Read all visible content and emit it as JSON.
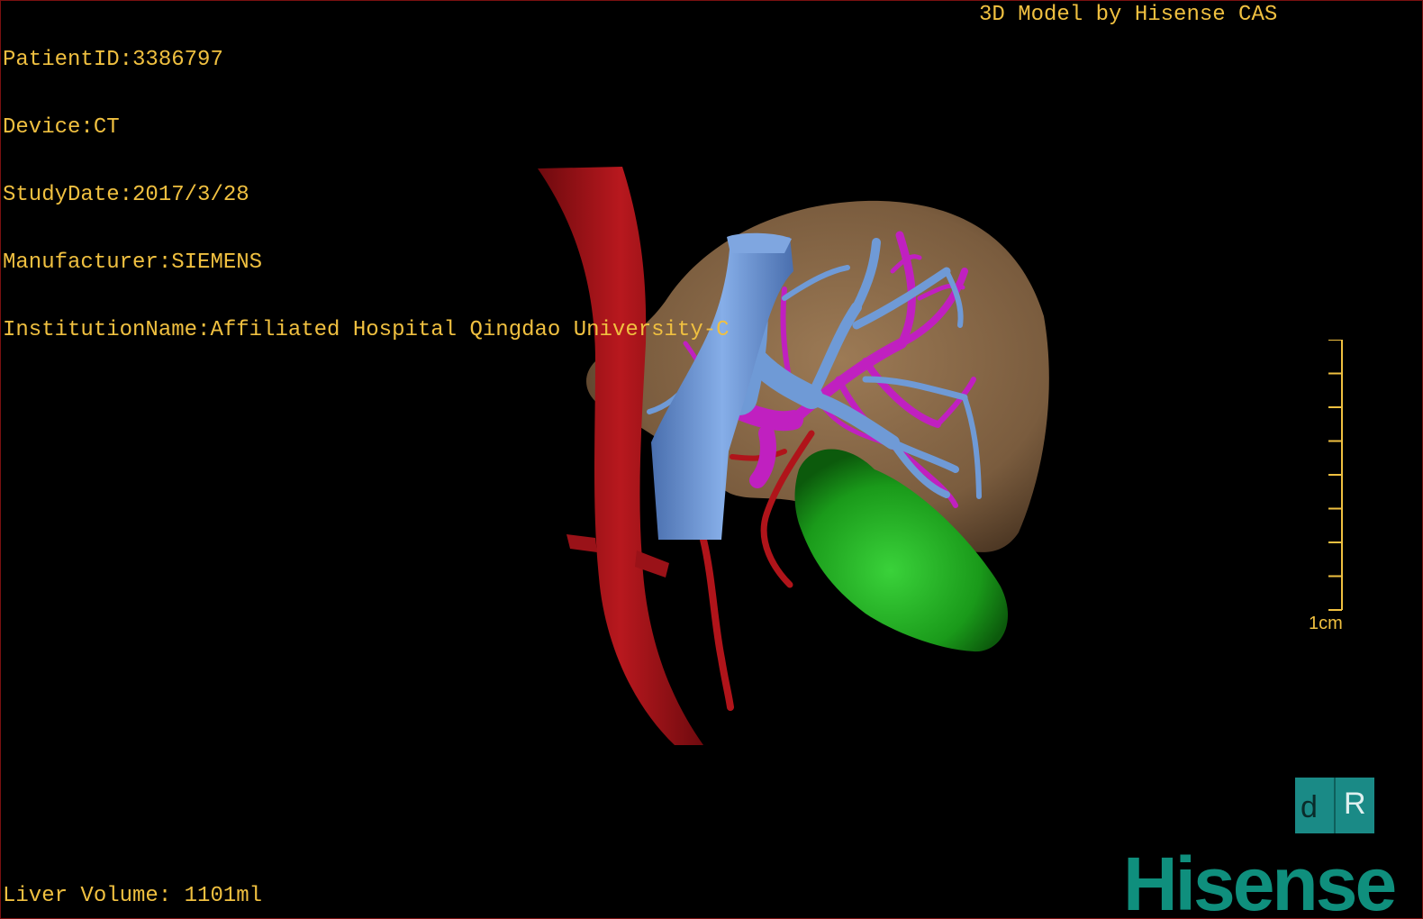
{
  "header": {
    "patient_id": "PatientID:3386797",
    "device": "Device:CT",
    "study_date": "StudyDate:2017/3/28",
    "manufacturer": "Manufacturer:SIEMENS",
    "institution": "InstitutionName:Affiliated Hospital Qingdao University-C"
  },
  "watermark": "3D Model by Hisense CAS",
  "footer": {
    "liver_volume": "Liver Volume: 1101ml"
  },
  "scale_bar": {
    "label": "1cm",
    "ticks": 8
  },
  "orientation_cube": {
    "left_glyph": "d",
    "right_glyph": "R",
    "color": "#1a8a86"
  },
  "brand": {
    "logo": "Hisense",
    "color": "#0f8f7d"
  },
  "colors": {
    "hud_text": "#f0c040",
    "liver": "#8a6a48",
    "aorta": "#a8141a",
    "portal_vein": "#6f9ad6",
    "hepatic_vein": "#c020c0",
    "gallbladder": "#1fa81f",
    "background": "#000000"
  }
}
